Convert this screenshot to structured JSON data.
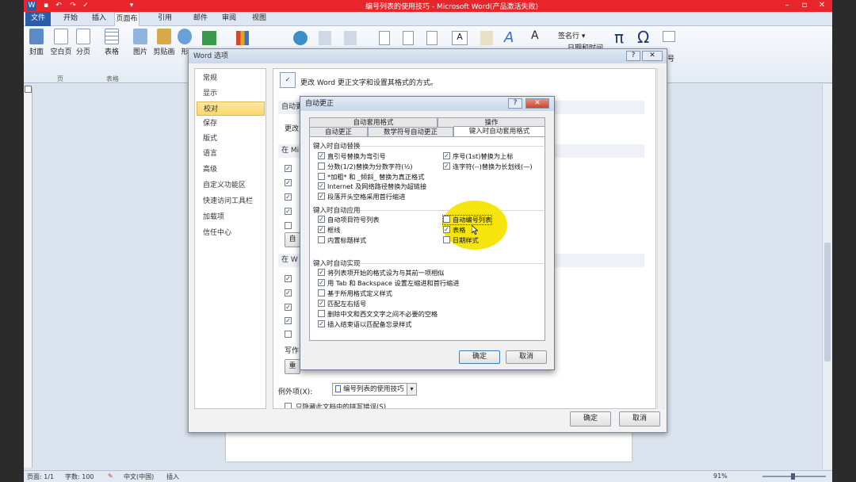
{
  "window": {
    "title": "编号列表的使用技巧 - Microsoft Word(产品激活失败)"
  },
  "ribbon_tabs": [
    "文件",
    "开始",
    "插入",
    "页面布局",
    "引用",
    "邮件",
    "审阅",
    "视图"
  ],
  "ribbon": {
    "buttons": [
      "封面",
      "空白页",
      "分页",
      "表格",
      "图片",
      "剪贴画",
      "形"
    ],
    "right_items": [
      "签名行",
      "日期和时间",
      "π",
      "Ω",
      "号"
    ],
    "groups": [
      "页",
      "表格"
    ]
  },
  "word_options": {
    "title": "Word 选项",
    "nav": [
      "常规",
      "显示",
      "校对",
      "保存",
      "版式",
      "语言",
      "高级",
      "自定义功能区",
      "快速访问工具栏",
      "加载项",
      "信任中心"
    ],
    "selected_nav": "校对",
    "header_text": "更改 Word 更正文字和设置其格式的方式。",
    "section1": "自动更",
    "row_partial": "更改",
    "section2": "在 Mi",
    "section3": "在 W",
    "writing_label": "写作",
    "btn_partial_1": "自",
    "btn_partial_2": "重",
    "exceptions_label": "例外项(X):",
    "exceptions_value": "编号列表的使用技巧",
    "bottom_check": "只隐藏此文档中的拼写错误(S)",
    "ok": "确定",
    "cancel": "取消"
  },
  "autocorrect": {
    "title": "自动更正",
    "tabs_row1": [
      "自动套用格式",
      "操作"
    ],
    "tabs_row2": [
      "自动更正",
      "数学符号自动更正",
      "键入时自动套用格式"
    ],
    "group1": {
      "title": "键入时自动替换",
      "left": [
        {
          "label": "直引号替换为弯引号",
          "checked": true
        },
        {
          "label": "分数(1/2)替换为分数字符(½)",
          "checked": false
        },
        {
          "label": "*加粗* 和 _倾斜_ 替换为真正格式",
          "checked": false
        },
        {
          "label": "Internet 及网络路径替换为超链接",
          "checked": true
        },
        {
          "label": "段落开头空格采用首行缩进",
          "checked": true
        }
      ],
      "right": [
        {
          "label": "序号(1st)替换为上标",
          "checked": true
        },
        {
          "label": "连字符(--)替换为长划线(—)",
          "checked": true
        }
      ]
    },
    "group2": {
      "title": "键入时自动应用",
      "left": [
        {
          "label": "自动项目符号列表",
          "checked": true
        },
        {
          "label": "框线",
          "checked": true
        },
        {
          "label": "内置标题样式",
          "checked": false
        }
      ],
      "right": [
        {
          "label": "自动编号列表",
          "checked": false
        },
        {
          "label": "表格",
          "checked": true
        },
        {
          "label": "日期样式",
          "checked": false
        }
      ]
    },
    "group3": {
      "title": "键入时自动实现",
      "items": [
        {
          "label": "将列表项开始的格式设为与其前一项相似",
          "checked": true
        },
        {
          "label": "用 Tab 和 Backspace 设置左缩进和首行缩进",
          "checked": true
        },
        {
          "label": "基于所用格式定义样式",
          "checked": false
        },
        {
          "label": "匹配左右括号",
          "checked": true
        },
        {
          "label": "删除中文和西文文字之间不必要的空格",
          "checked": false
        },
        {
          "label": "插入结束语以匹配备忘录样式",
          "checked": true
        }
      ]
    },
    "ok": "确定",
    "cancel": "取消"
  },
  "status": {
    "page": "页面: 1/1",
    "words": "字数: 100",
    "lang": "中文(中国)",
    "mode": "插入",
    "zoom": "91%"
  },
  "colors": {
    "titlebar": "#e8252a",
    "file_tab": "#2a5ca8",
    "highlight": "#f4e400"
  }
}
